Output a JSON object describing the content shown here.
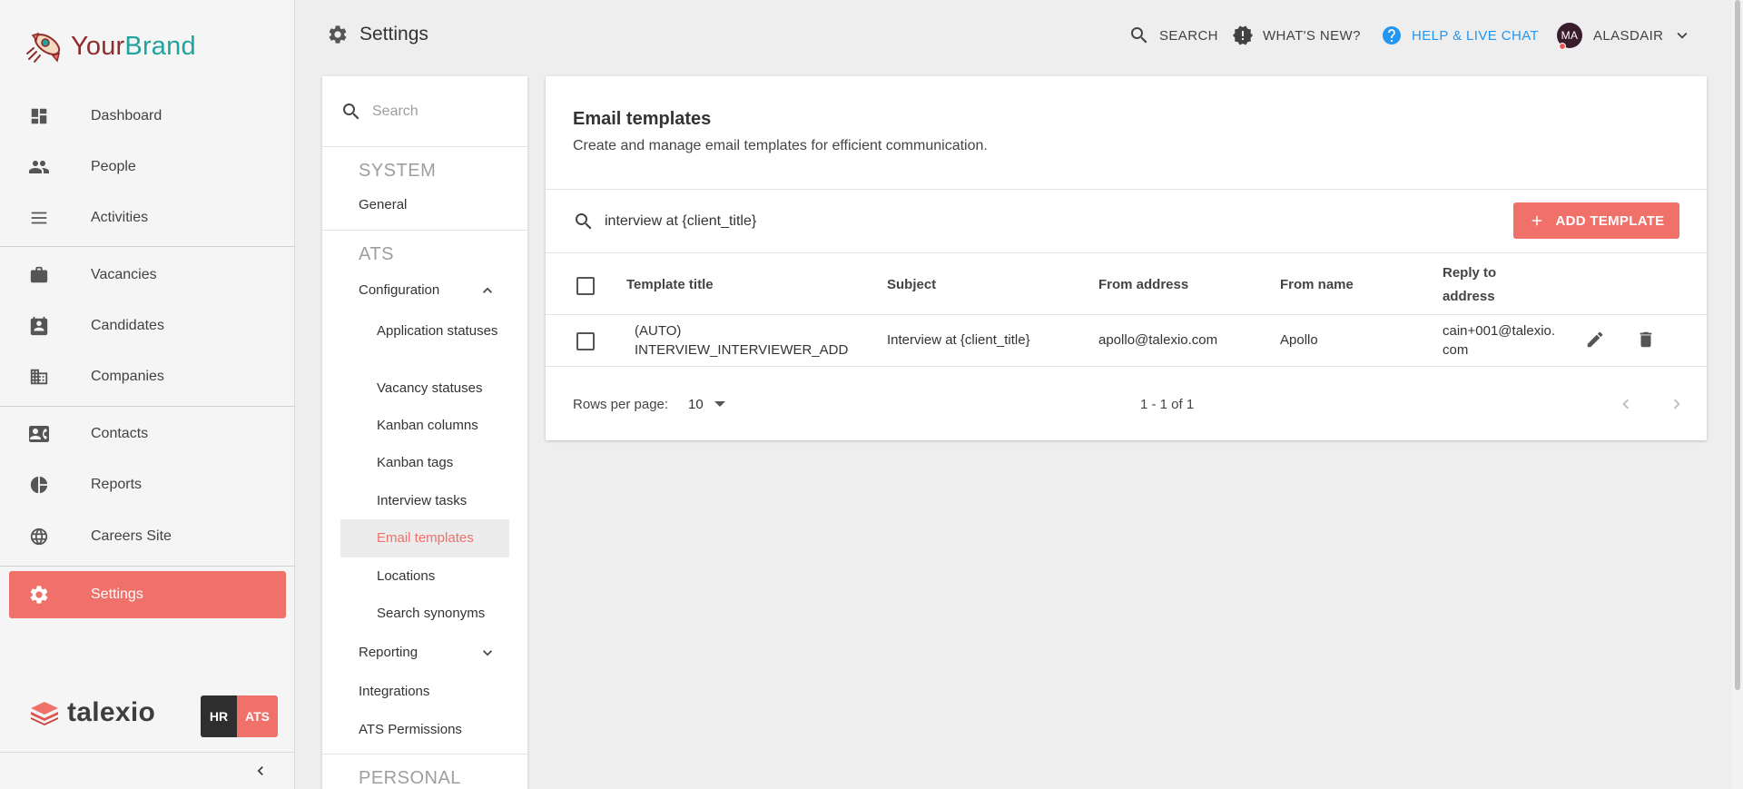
{
  "brand": {
    "name_part1": "Your",
    "name_part2": "Brand",
    "colors": {
      "dark": "#8e2c2c",
      "teal": "#20a39e"
    }
  },
  "sidebar": {
    "items": [
      {
        "label": "Dashboard",
        "icon": "dashboard-icon"
      },
      {
        "label": "People",
        "icon": "people-icon"
      },
      {
        "label": "Activities",
        "icon": "activities-icon"
      },
      {
        "label": "Vacancies",
        "icon": "briefcase-icon"
      },
      {
        "label": "Candidates",
        "icon": "candidate-card-icon"
      },
      {
        "label": "Companies",
        "icon": "building-icon"
      },
      {
        "label": "Contacts",
        "icon": "contact-card-icon"
      },
      {
        "label": "Reports",
        "icon": "pie-chart-icon"
      },
      {
        "label": "Careers Site",
        "icon": "globe-icon"
      },
      {
        "label": "Settings",
        "icon": "gear-icon",
        "active": true
      }
    ],
    "footer_logo": "talexio",
    "badge_hr": "HR",
    "badge_ats": "ATS",
    "accent": "#f0706a"
  },
  "header": {
    "title": "Settings",
    "search_label": "SEARCH",
    "whats_new_label": "WHAT'S NEW?",
    "help_label": "HELP & LIVE CHAT",
    "user_initials": "MA",
    "user_name": "ALASDAIR",
    "help_color": "#2196f3"
  },
  "settings_nav": {
    "search_placeholder": "Search",
    "system_heading": "SYSTEM",
    "general": "General",
    "ats_heading": "ATS",
    "configuration": "Configuration",
    "config_items": [
      "Application statuses",
      "Vacancy statuses",
      "Kanban columns",
      "Kanban tags",
      "Interview tasks",
      "Email templates",
      "Locations",
      "Search synonyms"
    ],
    "active_item": "Email templates",
    "reporting": "Reporting",
    "integrations": "Integrations",
    "ats_permissions": "ATS Permissions",
    "personal_heading": "PERSONAL"
  },
  "main": {
    "title": "Email templates",
    "subtitle": "Create and manage email templates for efficient communication.",
    "filter_value": "interview at {client_title}",
    "add_button": "ADD TEMPLATE",
    "columns": [
      "Template title",
      "Subject",
      "From address",
      "From name",
      "Reply to address"
    ],
    "rows": [
      {
        "template_title": "(AUTO) INTERVIEW_INTERVIEWER_ADD",
        "subject": "Interview at {client_title}",
        "from_address": "apollo@talexio.com",
        "from_name": "Apollo",
        "reply_to": "cain+001@talexio.com"
      }
    ],
    "pagination": {
      "rows_per_page_label": "Rows per page:",
      "rows_per_page": "10",
      "range": "1 - 1 of 1"
    }
  }
}
